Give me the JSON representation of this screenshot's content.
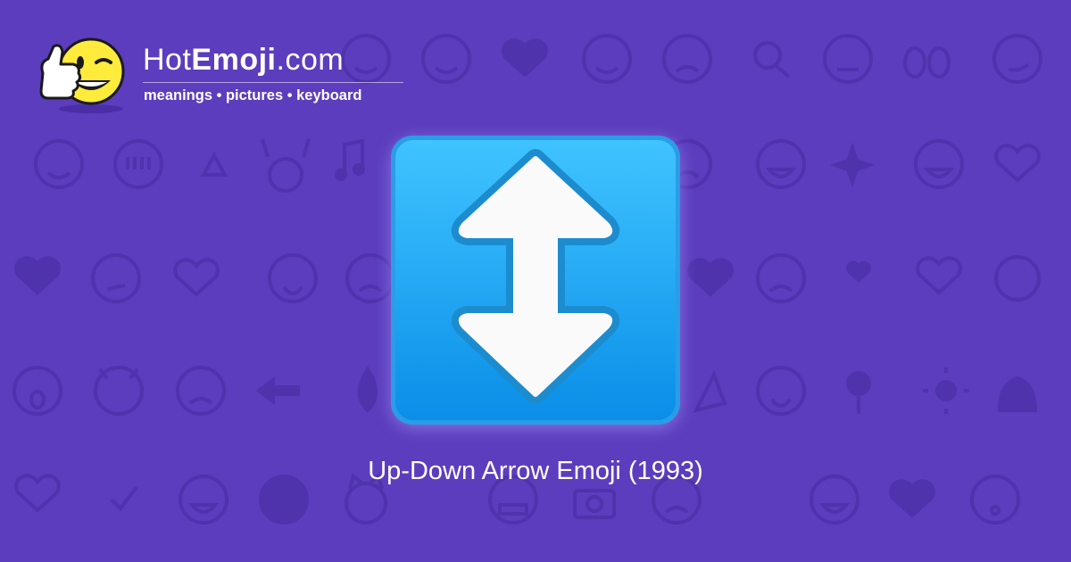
{
  "brand": {
    "name_part_plain": "Hot",
    "name_part_bold": "Emoji",
    "name_part_suffix": ".com",
    "tagline": "meanings • pictures • keyboard",
    "mascot_icon": "thumbs-up-winking-face-icon"
  },
  "emoji": {
    "icon": "up-down-arrow-icon",
    "caption": "Up-Down Arrow Emoji (1993)"
  },
  "colors": {
    "background": "#5b3dbd",
    "background_pattern": "#4f33ad",
    "tile_top": "#40c4ff",
    "tile_bottom": "#0a8ee8",
    "arrow_fill": "#fafafa",
    "mascot_face": "#ffeb3b"
  }
}
